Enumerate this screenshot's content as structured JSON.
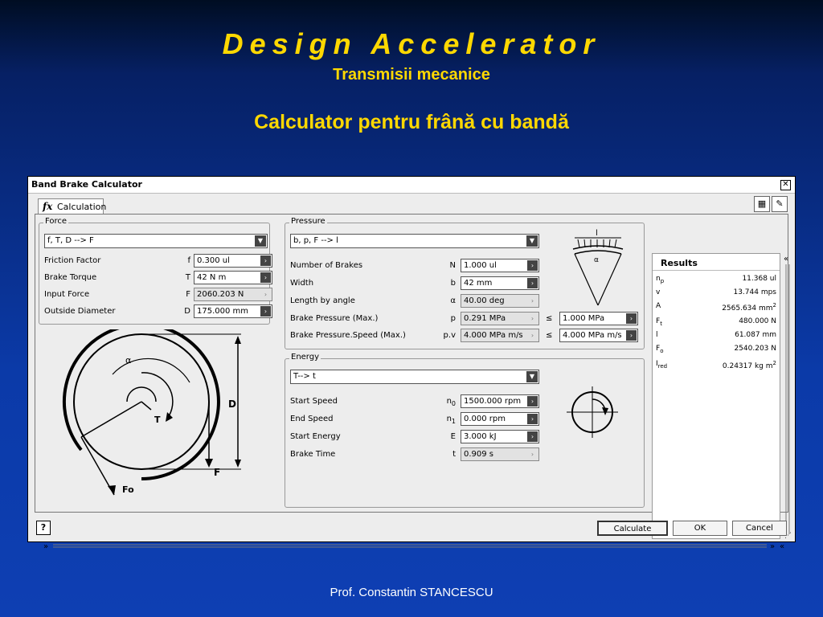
{
  "slide": {
    "title": "Design Accelerator",
    "subtitle": "Transmisii mecanice",
    "heading": "Calculator pentru frână cu bandă",
    "footer": "Prof. Constantin STANCESCU"
  },
  "window": {
    "title": "Band Brake Calculator",
    "close_icon": "close-icon",
    "tab_label": "Calculation",
    "tab_icon": "fx-icon"
  },
  "force": {
    "group_title": "Force",
    "mode": "f, T, D --> F",
    "rows": [
      {
        "label": "Friction Factor",
        "symbol": "f",
        "value": "0.300 ul",
        "readonly": false
      },
      {
        "label": "Brake Torque",
        "symbol": "T",
        "value": "42 N m",
        "readonly": false
      },
      {
        "label": "Input Force",
        "symbol": "F",
        "value": "2060.203 N",
        "readonly": true
      },
      {
        "label": "Outside Diameter",
        "symbol": "D",
        "value": "175.000 mm",
        "readonly": false
      }
    ]
  },
  "diagram": {
    "labels": {
      "alpha": "α",
      "torque": "T",
      "diameter": "D",
      "force": "F",
      "fo": "Fo"
    }
  },
  "pressure": {
    "group_title": "Pressure",
    "mode": "b, p, F --> l",
    "rows": [
      {
        "label": "Number of Brakes",
        "symbol": "N",
        "value": "1.000 ul",
        "readonly": false
      },
      {
        "label": "Width",
        "symbol": "b",
        "value": "42 mm",
        "readonly": false
      },
      {
        "label": "Length by angle",
        "symbol": "α",
        "value": "40.00 deg",
        "readonly": true
      },
      {
        "label": "Brake Pressure (Max.)",
        "symbol": "p",
        "value": "0.291 MPa",
        "readonly": true,
        "op": "≤",
        "limit": "1.000 MPa"
      },
      {
        "label": "Brake Pressure.Speed (Max.)",
        "symbol": "p.v",
        "value": "4.000 MPa m/s",
        "readonly": true,
        "op": "≤",
        "limit": "4.000 MPa m/s"
      }
    ],
    "diagram_labels": {
      "l": "l",
      "alpha": "α"
    }
  },
  "energy": {
    "group_title": "Energy",
    "mode": "T--> t",
    "rows": [
      {
        "label": "Start Speed",
        "symbol": "n",
        "sub": "0",
        "value": "1500.000 rpm",
        "readonly": false
      },
      {
        "label": "End Speed",
        "symbol": "n",
        "sub": "1",
        "value": "0.000 rpm",
        "readonly": false
      },
      {
        "label": "Start Energy",
        "symbol": "E",
        "sub": "",
        "value": "3.000 kJ",
        "readonly": false
      },
      {
        "label": "Brake Time",
        "symbol": "t",
        "sub": "",
        "value": "0.909 s",
        "readonly": true
      }
    ]
  },
  "results": {
    "title": "Results",
    "rows": [
      {
        "symbol": "n",
        "sub": "p",
        "value": "11.368 ul"
      },
      {
        "symbol": "v",
        "sub": "",
        "value": "13.744 mps"
      },
      {
        "symbol": "A",
        "sub": "",
        "value": "2565.634 mm",
        "sup": "2"
      },
      {
        "symbol": "F",
        "sub": "t",
        "value": "480.000 N"
      },
      {
        "symbol": "l",
        "sub": "",
        "value": "61.087 mm"
      },
      {
        "symbol": "F",
        "sub": "o",
        "value": "2540.203 N"
      },
      {
        "symbol": "I",
        "sub": "red",
        "value": "0.24317 kg m",
        "sup": "2"
      }
    ]
  },
  "buttons": {
    "help": "?",
    "calculate": "Calculate",
    "ok": "OK",
    "cancel": "Cancel"
  }
}
